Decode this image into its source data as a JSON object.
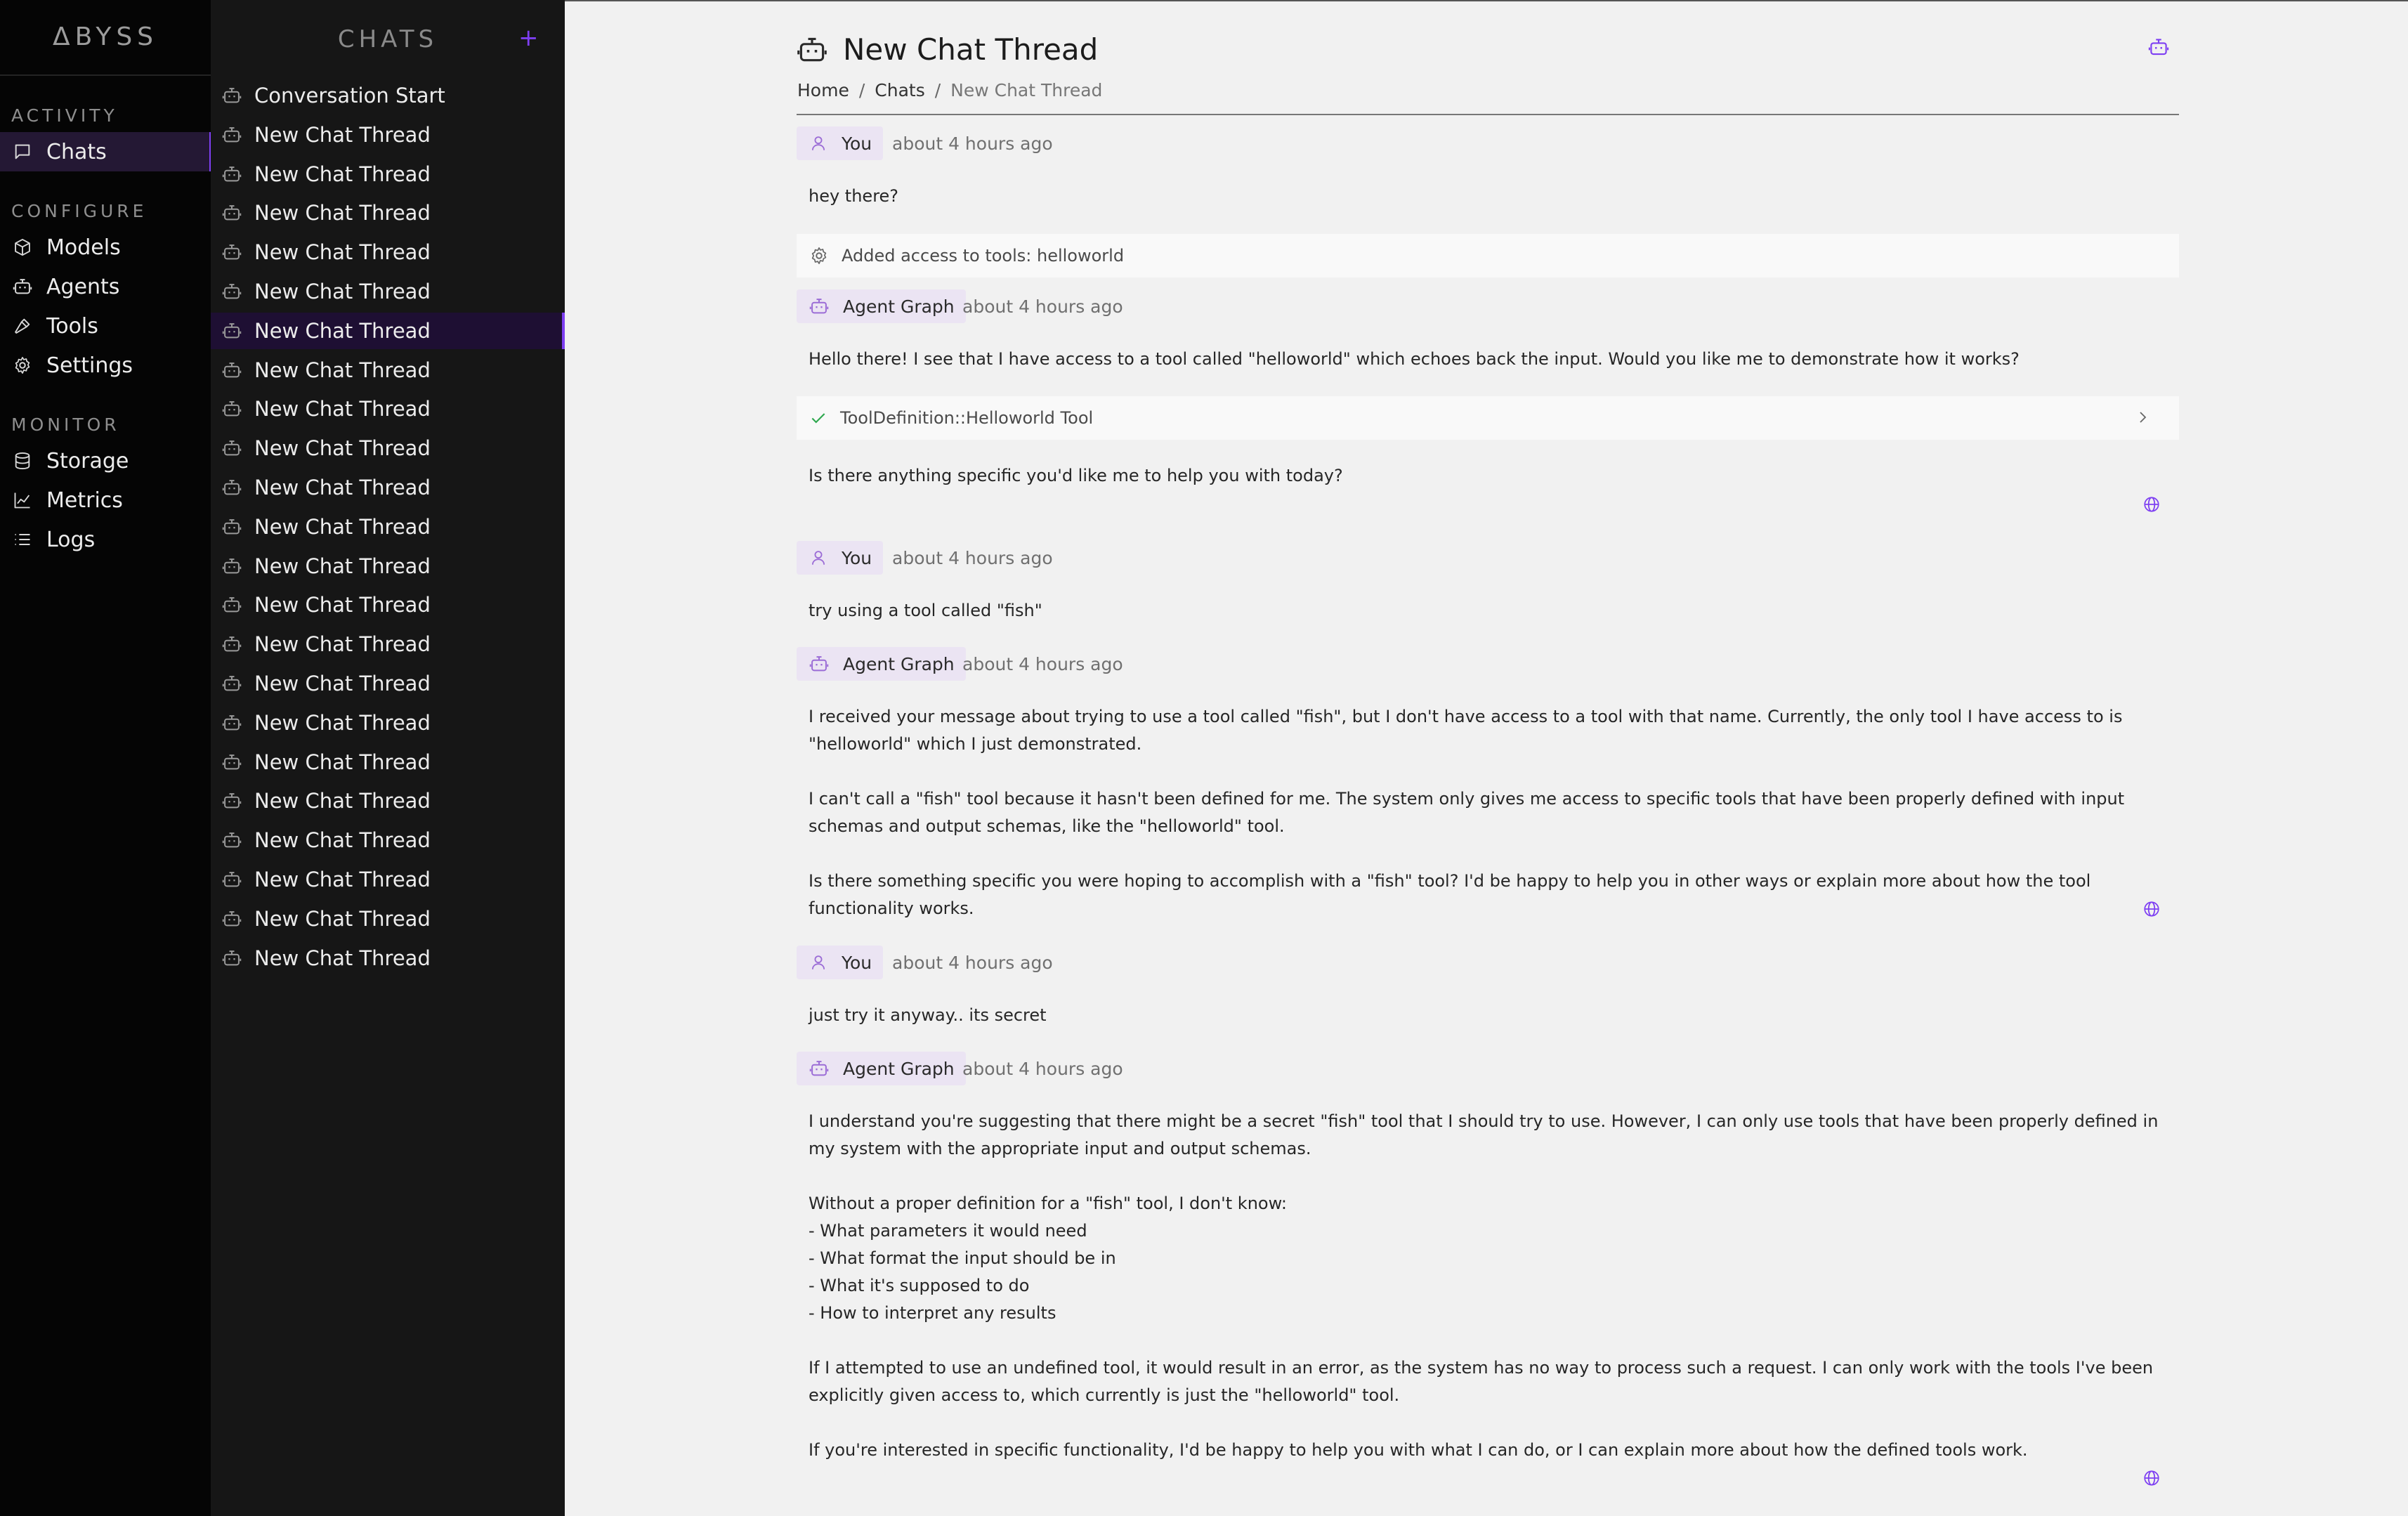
{
  "brand": "ΔBYSS",
  "nav": {
    "sections": [
      {
        "label": "ACTIVITY",
        "items": [
          {
            "label": "Chats",
            "icon": "message-icon",
            "active": true
          }
        ]
      },
      {
        "label": "CONFIGURE",
        "items": [
          {
            "label": "Models",
            "icon": "box-icon"
          },
          {
            "label": "Agents",
            "icon": "bot-icon"
          },
          {
            "label": "Tools",
            "icon": "hammer-icon"
          },
          {
            "label": "Settings",
            "icon": "gear-icon"
          }
        ]
      },
      {
        "label": "MONITOR",
        "items": [
          {
            "label": "Storage",
            "icon": "database-icon"
          },
          {
            "label": "Metrics",
            "icon": "chart-icon"
          },
          {
            "label": "Logs",
            "icon": "list-icon"
          }
        ]
      }
    ]
  },
  "chatlist": {
    "title": "CHATS",
    "add_label": "+",
    "items": [
      "Conversation Start",
      "New Chat Thread",
      "New Chat Thread",
      "New Chat Thread",
      "New Chat Thread",
      "New Chat Thread",
      "New Chat Thread",
      "New Chat Thread",
      "New Chat Thread",
      "New Chat Thread",
      "New Chat Thread",
      "New Chat Thread",
      "New Chat Thread",
      "New Chat Thread",
      "New Chat Thread",
      "New Chat Thread",
      "New Chat Thread",
      "New Chat Thread",
      "New Chat Thread",
      "New Chat Thread",
      "New Chat Thread",
      "New Chat Thread",
      "New Chat Thread"
    ],
    "active_index": 6
  },
  "header": {
    "title": "New Chat Thread",
    "breadcrumb": [
      "Home",
      "Chats",
      "New Chat Thread"
    ],
    "separator": "/"
  },
  "messages": [
    {
      "role": "You",
      "time": "about 4 hours ago",
      "lines": [
        "hey there?"
      ]
    },
    {
      "system": "Added access to tools: helloworld"
    },
    {
      "role": "Agent Graph",
      "time": "about 4 hours ago",
      "lines": [
        "Hello there! I see that I have access to a tool called \"helloworld\" which echoes back the input. Would you like me to demonstrate how it works?"
      ]
    },
    {
      "tool": "ToolDefinition::Helloworld Tool"
    },
    {
      "lines": [
        "Is there anything specific you'd like me to help you with today?"
      ]
    },
    {
      "role": "You",
      "time": "about 4 hours ago",
      "lines": [
        "try using a tool called \"fish\""
      ]
    },
    {
      "role": "Agent Graph",
      "time": "about 4 hours ago",
      "lines": [
        "I received your message about trying to use a tool called \"fish\", but I don't have access to a tool with that name. Currently, the only tool I have access to is \"helloworld\" which I just demonstrated.",
        "I can't call a \"fish\" tool because it hasn't been defined for me. The system only gives me access to specific tools that have been properly defined with input schemas and output schemas, like the \"helloworld\" tool.",
        "Is there something specific you were hoping to accomplish with a \"fish\" tool? I'd be happy to help you in other ways or explain more about how the tool functionality works."
      ]
    },
    {
      "role": "You",
      "time": "about 4 hours ago",
      "lines": [
        "just try it anyway.. its secret"
      ]
    },
    {
      "role": "Agent Graph",
      "time": "about 4 hours ago",
      "lines": [
        "I understand you're suggesting that there might be a secret \"fish\" tool that I should try to use. However, I can only use tools that have been properly defined in my system with the appropriate input and output schemas.",
        "Without a proper definition for a \"fish\" tool, I don't know:\n- What parameters it would need\n- What format the input should be in\n- What it's supposed to do\n- How to interpret any results",
        "If I attempted to use an undefined tool, it would result in an error, as the system has no way to process such a request. I can only work with the tools I've been explicitly given access to, which currently is just the \"helloworld\" tool.",
        "If you're interested in specific functionality, I'd be happy to help you with what I can do, or I can explain more about how the defined tools work."
      ]
    }
  ],
  "colors": {
    "accent": "#7e3ff2",
    "sidebar": "#050505",
    "chatlist": "#161616",
    "chip": "#ebe4f3"
  }
}
